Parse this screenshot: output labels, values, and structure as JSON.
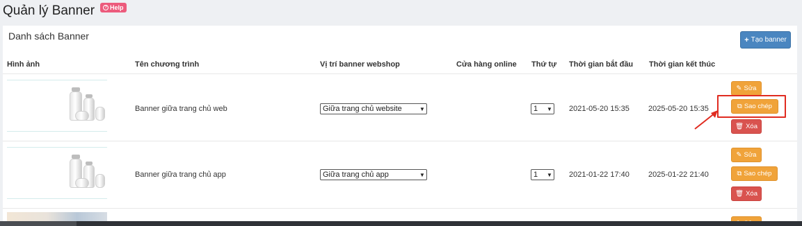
{
  "header": {
    "title": "Quản lý Banner",
    "help_label": "Help"
  },
  "panel": {
    "title": "Danh sách Banner",
    "create_button": "Tạo banner"
  },
  "table": {
    "columns": [
      "Hình ảnh",
      "Tên chương trình",
      "Vị trí banner webshop",
      "Cửa hàng online",
      "Thứ tự",
      "Thời gian bắt đầu",
      "Thời gian kết thúc"
    ],
    "rows": [
      {
        "name": "Banner giữa trang chủ web",
        "position": "Giữa trang chủ website",
        "order": "1",
        "start": "2021-05-20 15:35",
        "end": "2025-05-20 15:35"
      },
      {
        "name": "Banner giữa trang chủ app",
        "position": "Giữa trang chủ app",
        "order": "1",
        "start": "2021-01-22 17:40",
        "end": "2025-01-22 21:40"
      }
    ]
  },
  "actions": {
    "edit": "Sửa",
    "copy": "Sao chép",
    "delete": "Xóa"
  },
  "colors": {
    "edit": "#f0a33a",
    "copy": "#f0a33a",
    "delete": "#d9534f",
    "primary": "#4a86c0",
    "highlight": "#e02b20"
  },
  "icons": {
    "help": "question-circle-icon",
    "create": "plus-icon",
    "edit": "pencil-icon",
    "copy": "copy-icon",
    "delete": "trash-icon"
  }
}
